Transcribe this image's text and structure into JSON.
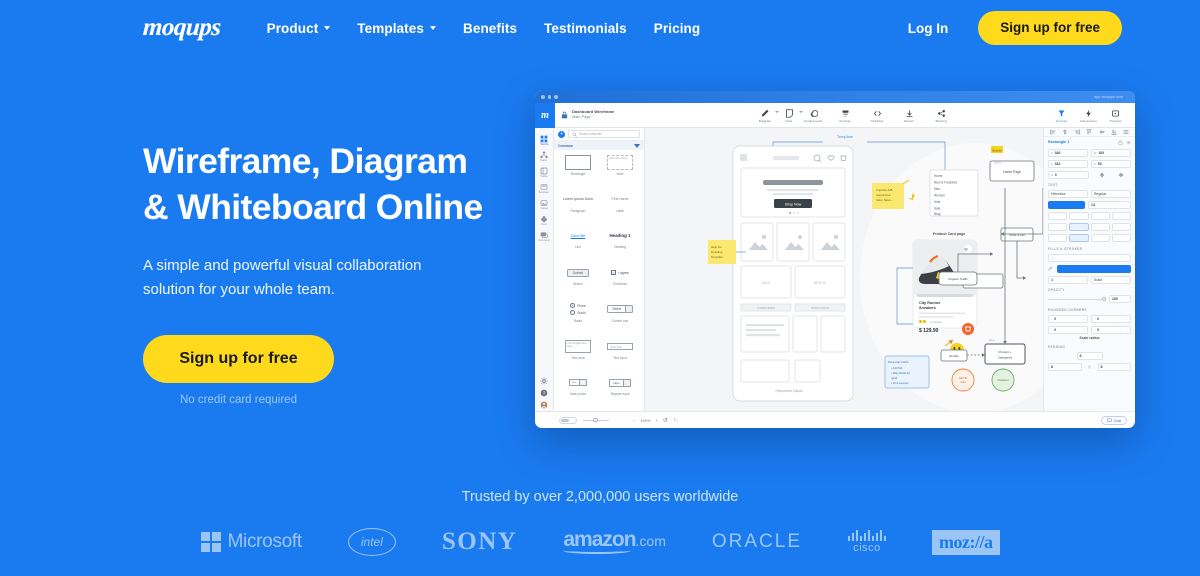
{
  "brand": {
    "logo": "moqups",
    "accent_blue": "#1a7bf0",
    "accent_yellow": "#ffd91c"
  },
  "nav": {
    "links": [
      {
        "label": "Product",
        "has_caret": true
      },
      {
        "label": "Templates",
        "has_caret": true
      },
      {
        "label": "Benefits",
        "has_caret": false
      },
      {
        "label": "Testimonials",
        "has_caret": false
      },
      {
        "label": "Pricing",
        "has_caret": false
      }
    ],
    "login": "Log In",
    "signup": "Sign up for free"
  },
  "hero": {
    "title_line1": "Wireframe, Diagram",
    "title_line2": "& Whiteboard Online",
    "subtitle": "A simple and powerful visual collaboration solution for your whole team.",
    "cta": "Sign up for free",
    "note": "No credit card required"
  },
  "app": {
    "url": "app.moqups.com",
    "doc_title": "Dashboard Wireframe",
    "doc_page": "Main Page",
    "logo_letter": "m",
    "toolbar": [
      {
        "label": "Diagram",
        "icon": "pen-icon"
      },
      {
        "label": "Note",
        "icon": "note-icon"
      },
      {
        "label": "Components",
        "icon": "components-icon"
      },
      {
        "label": "Arrange",
        "icon": "arrange-icon"
      },
      {
        "label": "HubSpot",
        "icon": "code-icon"
      },
      {
        "label": "Export",
        "icon": "export-icon"
      },
      {
        "label": "Sharing",
        "icon": "share-icon"
      }
    ],
    "toolbar_right": [
      {
        "label": "Format",
        "icon": "format-icon",
        "active": true
      },
      {
        "label": "Interactions",
        "icon": "bolt-icon",
        "active": false
      },
      {
        "label": "Preview",
        "icon": "preview-icon",
        "active": false
      }
    ],
    "rail": [
      {
        "label": "Stencils",
        "icon": "stencils-icon",
        "active": true
      },
      {
        "label": "Teams",
        "icon": "teams-icon",
        "active": false
      },
      {
        "label": "Outline",
        "icon": "outline-icon",
        "active": false
      },
      {
        "label": "Templates",
        "icon": "templates-icon",
        "active": false
      },
      {
        "label": "Images",
        "icon": "images-icon",
        "active": false
      },
      {
        "label": "Icons",
        "icon": "icons-icon",
        "active": false
      },
      {
        "label": "Comments",
        "icon": "comments-icon",
        "active": false
      }
    ],
    "stencils": {
      "search_placeholder": "Search stencils",
      "group": "Common",
      "items": [
        {
          "label": "Rectangle",
          "preview": "rectangle"
        },
        {
          "label": "Note",
          "preview": "note"
        },
        {
          "label": "Paragraph",
          "preview": "Lorem Ipsum Dolor"
        },
        {
          "label": "Label",
          "preview": "First name"
        },
        {
          "label": "Link",
          "preview": "Click Me"
        },
        {
          "label": "Heading",
          "preview": "Heading 1"
        },
        {
          "label": "Button",
          "preview": "Submit"
        },
        {
          "label": "Checkbox",
          "preview": "I agree"
        },
        {
          "label": "Radio",
          "preview": "Pizza / Sushi"
        },
        {
          "label": "Combo box",
          "preview": "Select"
        },
        {
          "label": "Text area",
          "preview": "Your longest text here"
        },
        {
          "label": "Text input",
          "preview": "John Doe"
        },
        {
          "label": "Date picker",
          "preview": "date"
        },
        {
          "label": "Stepper input",
          "preview": "12px"
        }
      ]
    },
    "canvas": {
      "frame_label": "Template",
      "mobile": {
        "hero_button": "Shop Now",
        "notes": [
          "Help me including Template",
          "Improve A/B responsive, More..."
        ],
        "footer_label": "Responsive Layout"
      },
      "menu_items": [
        "Home",
        "New & Featured",
        "Men",
        "Women",
        "Kids",
        "Sale",
        "Blog"
      ],
      "product": {
        "section_title": "Product Card page",
        "name": "City Runner Sneakers",
        "price": "$ 129.90",
        "rating": "2 reviews"
      },
      "flow": {
        "nodes": [
          "Home Page",
          "Shop & Life",
          "Organic Traffic",
          "Emails",
          "Product Categories",
          "Add to cart",
          "Checkout",
          "Login / Sign Up",
          "Cart",
          "More product for browse",
          "Payment + Shipment"
        ],
        "decision": "Verify Address & Coupon",
        "badge": "Browse"
      },
      "checklist_title": "Checkout flow",
      "form_note": "Personal Card"
    },
    "properties": {
      "selection": "Rectangle 1",
      "x": {
        "key": "x",
        "value": "340"
      },
      "y": {
        "key": "y",
        "value": "332"
      },
      "w": {
        "key": "w",
        "value": "100"
      },
      "h": {
        "key": "h",
        "value": "50"
      },
      "angle": {
        "key": "a",
        "value": "0"
      },
      "sections": {
        "text": "TEXT",
        "fills": "FILLS & STROKES",
        "opacity": "OPACITY",
        "corners": "ROUNDED CORNERS",
        "padding": "PADDING"
      },
      "font_family": "Helvetica",
      "font_weight": "Regular",
      "font_size": "14",
      "stroke_width": "1",
      "stroke_style": "Solid",
      "opacity_value": "100",
      "corner_values": [
        "0",
        "0",
        "0",
        "0"
      ],
      "scale_radius": "Scale radius",
      "padding_value": "8"
    },
    "status": {
      "zoom": "100%",
      "chat": "Chat"
    }
  },
  "trust": {
    "text": "Trusted by over 2,000,000 users worldwide",
    "logos": [
      {
        "name": "Microsoft",
        "label": "Microsoft"
      },
      {
        "name": "Intel",
        "label": "intel"
      },
      {
        "name": "Sony",
        "label": "SONY"
      },
      {
        "name": "Amazon",
        "label": "amazon",
        "suffix": ".com"
      },
      {
        "name": "Oracle",
        "label": "ORACLE"
      },
      {
        "name": "Cisco",
        "label": "cisco"
      },
      {
        "name": "Mozilla",
        "label": "moz://a"
      }
    ]
  }
}
